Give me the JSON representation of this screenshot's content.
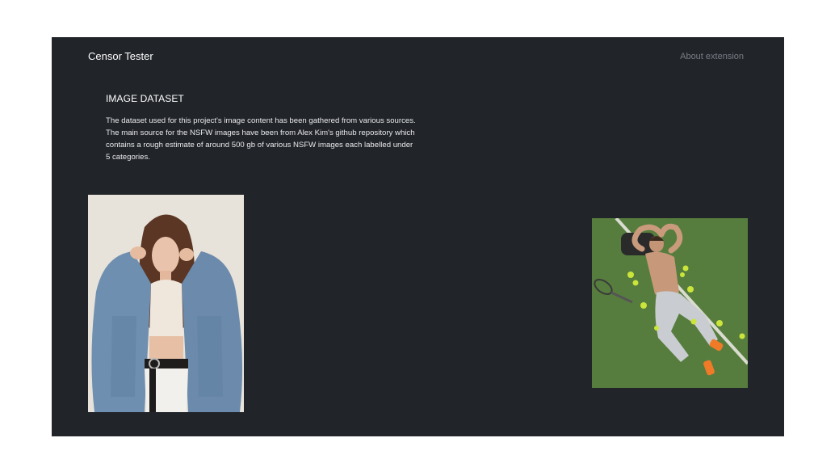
{
  "header": {
    "brand": "Censor Tester",
    "about_link": "About extension"
  },
  "section": {
    "title": "IMAGE DATASET",
    "body": "The dataset used for this project's image content has been gathered from various sources. The main source for the NSFW images have been from Alex Kim's github repository which contains a rough estimate of around 500 gb of various NSFW images each labelled under 5 categories."
  },
  "colors": {
    "page_bg": "#ffffff",
    "app_bg": "#212429",
    "text": "#ffffff",
    "muted_link": "#7a7e85"
  },
  "images": [
    {
      "icon": "photo-woman-denim-jacket"
    },
    {
      "icon": "photo-man-tennis-court"
    }
  ]
}
